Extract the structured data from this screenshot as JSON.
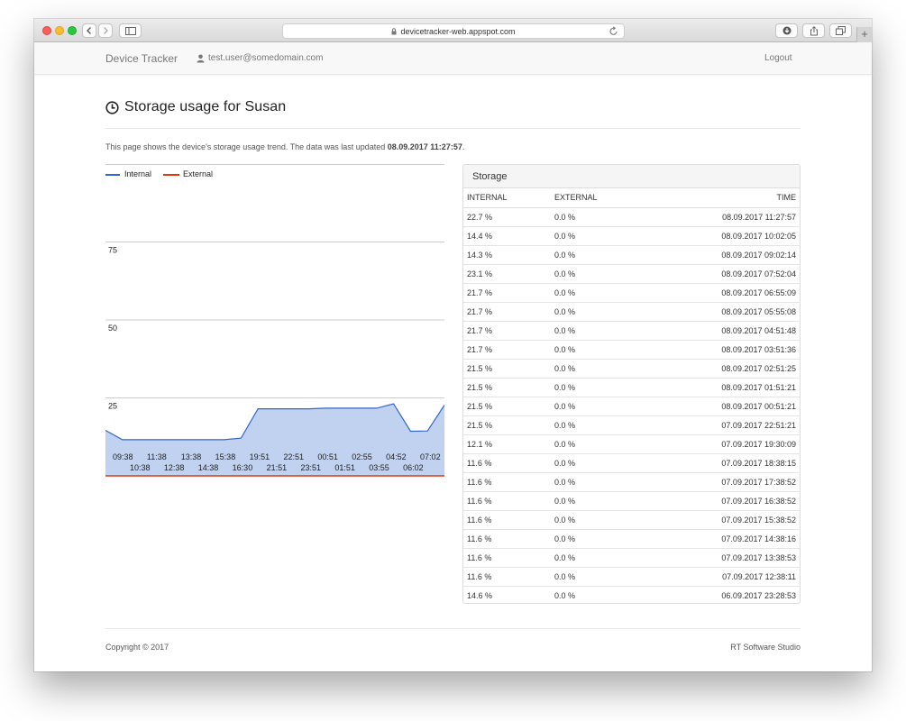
{
  "browser": {
    "url": "devicetracker-web.appspot.com"
  },
  "navbar": {
    "brand": "Device Tracker",
    "user_email": "test.user@somedomain.com",
    "logout_label": "Logout"
  },
  "page": {
    "title": "Storage usage for Susan",
    "description_prefix": "This page shows the device's storage usage trend. The data was last updated ",
    "last_updated": "08.09.2017 11:27:57",
    "description_suffix": "."
  },
  "colors": {
    "internal": "#3366cc",
    "external": "#dc3912",
    "area_fill": "#c1d1f0"
  },
  "chart_data": {
    "type": "area",
    "legend": [
      "Internal",
      "External"
    ],
    "legend_position": "top-left",
    "y_ticks": [
      "75",
      "50",
      "25"
    ],
    "ylim": [
      0,
      100
    ],
    "grid": true,
    "x_labels_row1": [
      "09:38",
      "11:38",
      "13:38",
      "15:38",
      "19:51",
      "22:51",
      "00:51",
      "02:55",
      "04:52",
      "07:02"
    ],
    "x_labels_row2": [
      "10:38",
      "12:38",
      "14:38",
      "16:30",
      "21:51",
      "23:51",
      "01:51",
      "03:55",
      "06:02"
    ],
    "series": [
      {
        "name": "Internal",
        "values": [
          14.6,
          11.6,
          11.6,
          11.6,
          11.6,
          11.6,
          11.6,
          11.6,
          12.1,
          21.5,
          21.5,
          21.5,
          21.5,
          21.7,
          21.7,
          21.7,
          21.7,
          23.1,
          14.3,
          14.4,
          22.7
        ]
      },
      {
        "name": "External",
        "values": [
          0,
          0,
          0,
          0,
          0,
          0,
          0,
          0,
          0,
          0,
          0,
          0,
          0,
          0,
          0,
          0,
          0,
          0,
          0,
          0,
          0
        ]
      }
    ]
  },
  "storage": {
    "title": "Storage",
    "headers": {
      "internal": "INTERNAL",
      "external": "EXTERNAL",
      "time": "TIME"
    },
    "rows": [
      {
        "internal": "22.7 %",
        "external": "0.0 %",
        "time": "08.09.2017 11:27:57"
      },
      {
        "internal": "14.4 %",
        "external": "0.0 %",
        "time": "08.09.2017 10:02:05"
      },
      {
        "internal": "14.3 %",
        "external": "0.0 %",
        "time": "08.09.2017 09:02:14"
      },
      {
        "internal": "23.1 %",
        "external": "0.0 %",
        "time": "08.09.2017 07:52:04"
      },
      {
        "internal": "21.7 %",
        "external": "0.0 %",
        "time": "08.09.2017 06:55:09"
      },
      {
        "internal": "21.7 %",
        "external": "0.0 %",
        "time": "08.09.2017 05:55:08"
      },
      {
        "internal": "21.7 %",
        "external": "0.0 %",
        "time": "08.09.2017 04:51:48"
      },
      {
        "internal": "21.7 %",
        "external": "0.0 %",
        "time": "08.09.2017 03:51:36"
      },
      {
        "internal": "21.5 %",
        "external": "0.0 %",
        "time": "08.09.2017 02:51:25"
      },
      {
        "internal": "21.5 %",
        "external": "0.0 %",
        "time": "08.09.2017 01:51:21"
      },
      {
        "internal": "21.5 %",
        "external": "0.0 %",
        "time": "08.09.2017 00:51:21"
      },
      {
        "internal": "21.5 %",
        "external": "0.0 %",
        "time": "07.09.2017 22:51:21"
      },
      {
        "internal": "12.1 %",
        "external": "0.0 %",
        "time": "07.09.2017 19:30:09"
      },
      {
        "internal": "11.6 %",
        "external": "0.0 %",
        "time": "07.09.2017 18:38:15"
      },
      {
        "internal": "11.6 %",
        "external": "0.0 %",
        "time": "07.09.2017 17:38:52"
      },
      {
        "internal": "11.6 %",
        "external": "0.0 %",
        "time": "07.09.2017 16:38:52"
      },
      {
        "internal": "11.6 %",
        "external": "0.0 %",
        "time": "07.09.2017 15:38:52"
      },
      {
        "internal": "11.6 %",
        "external": "0.0 %",
        "time": "07.09.2017 14:38:16"
      },
      {
        "internal": "11.6 %",
        "external": "0.0 %",
        "time": "07.09.2017 13:38:53"
      },
      {
        "internal": "11.6 %",
        "external": "0.0 %",
        "time": "07.09.2017 12:38:11"
      },
      {
        "internal": "14.6 %",
        "external": "0.0 %",
        "time": "06.09.2017 23:28:53"
      }
    ]
  },
  "footer": {
    "copyright": "Copyright © 2017",
    "company": "RT Software Studio"
  }
}
